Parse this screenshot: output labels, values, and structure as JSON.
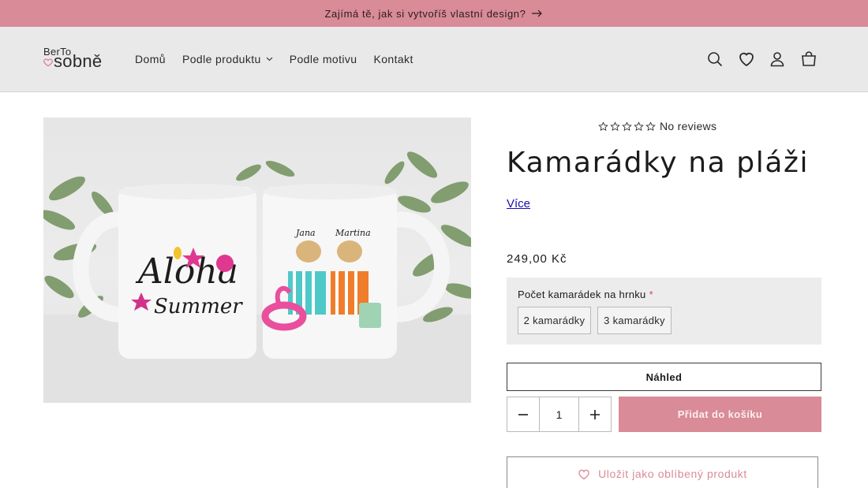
{
  "announcement": {
    "text": "Zajímá tě, jak si vytvoříš vlastní design?",
    "icon": "arrow-right-icon"
  },
  "logo": {
    "line1": "BerTo",
    "line2": "sobně",
    "icon": "heart-icon"
  },
  "nav": {
    "items": [
      {
        "label": "Domů",
        "has_dropdown": false
      },
      {
        "label": "Podle produktu",
        "has_dropdown": true
      },
      {
        "label": "Podle motivu",
        "has_dropdown": false
      },
      {
        "label": "Kontakt",
        "has_dropdown": false
      }
    ]
  },
  "header_icons": [
    "search-icon",
    "heart-icon",
    "account-icon",
    "cart-icon"
  ],
  "product": {
    "reviews_text": "No reviews",
    "rating": 0,
    "rating_max": 5,
    "title": "Kamarádky na pláži",
    "more_link": "Více",
    "price": "249,00 Kč",
    "image": {
      "mug_left_text_1": "Aloha",
      "mug_left_text_2": "Summer",
      "mug_right_name_1": "Jana",
      "mug_right_name_2": "Martina"
    }
  },
  "option": {
    "label": "Počet kamarádek na hrnku",
    "required_mark": "*",
    "choices": [
      "2 kamarádky",
      "3 kamarádky"
    ]
  },
  "actions": {
    "preview_label": "Náhled",
    "quantity": "1",
    "add_to_cart_label": "Přidat do košíku",
    "wishlist_label": "Uložit jako oblíbený produkt"
  },
  "colors": {
    "accent": "#d98b97",
    "header_bg": "#e9e9e9",
    "link": "#1a0dab",
    "required": "#d44858"
  }
}
